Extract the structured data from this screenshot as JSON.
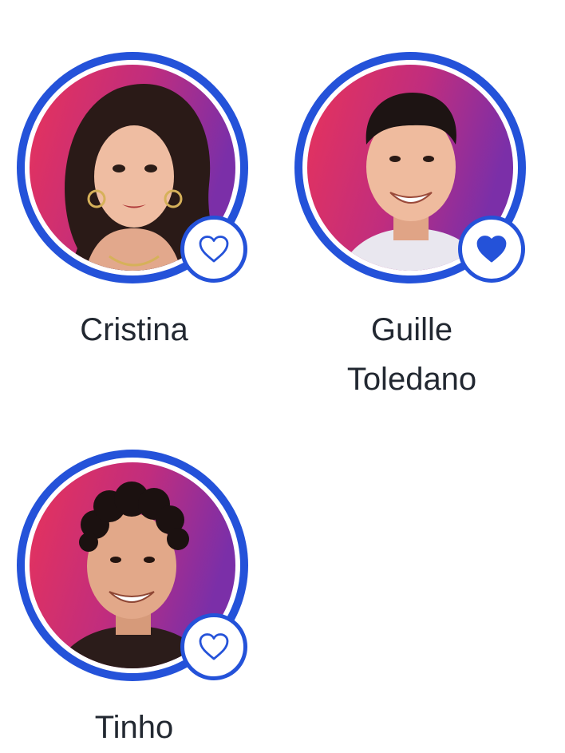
{
  "accent_color": "#2452d9",
  "contestants": [
    {
      "name": "Cristina",
      "favorited": false,
      "icon": "heart-outline-icon"
    },
    {
      "name": "Guille Toledano",
      "name_lines": [
        "Guille",
        "Toledano"
      ],
      "favorited": true,
      "icon": "heart-filled-icon"
    },
    {
      "name": "Tinho",
      "favorited": false,
      "icon": "heart-outline-icon"
    }
  ]
}
